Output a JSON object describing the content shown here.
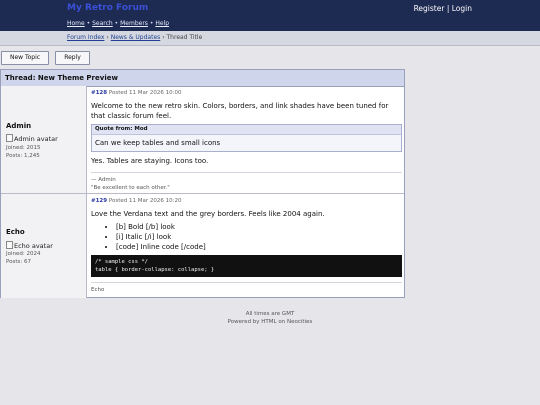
{
  "site": {
    "title": "My Retro Forum",
    "nav": [
      "Home",
      "Search",
      "Members",
      "Help"
    ],
    "nav_sep": "•",
    "auth": {
      "register": "Register",
      "sep": "|",
      "login": "Login"
    }
  },
  "breadcrumb": {
    "items": [
      "Forum Index",
      "News & Updates",
      "Thread Title"
    ],
    "sep": "›"
  },
  "actions": {
    "new_topic": "New Topic",
    "reply": "Reply"
  },
  "thread": {
    "title": "Thread: New Theme Preview",
    "posts": [
      {
        "author": "Admin",
        "avatar_alt": "Admin avatar",
        "joined": "Joined: 2015",
        "posts": "Posts: 1,245",
        "id": "#128",
        "date": "Posted 11 Mar 2026 10:00",
        "text1": "Welcome to the new retro skin. Colors, borders, and link shades have been tuned for that classic forum feel.",
        "quote": {
          "header": "Quote from: Mod",
          "body": "Can we keep tables and small icons"
        },
        "text2": "Yes. Tables are staying. Icons too.",
        "sig1": "— Admin",
        "sig2": "\"Be excellent to each other.\""
      },
      {
        "author": "Echo",
        "avatar_alt": "Echo avatar",
        "joined": "Joined: 2024",
        "posts": "Posts: 67",
        "id": "#129",
        "date": "Posted 11 Mar 2026 10:20",
        "text1": "Love the Verdana text and the grey borders. Feels like 2004 again.",
        "list": [
          "[b] Bold [/b] look",
          "[i] Italic [/i] look",
          "[code] Inline code [/code]"
        ],
        "code": [
          "/* sample css */",
          "table { border-collapse: collapse; }"
        ],
        "sig": "Echo"
      }
    ]
  },
  "footer": {
    "line1": "All times are GMT",
    "line2": "Powered by HTML on Neocities"
  }
}
